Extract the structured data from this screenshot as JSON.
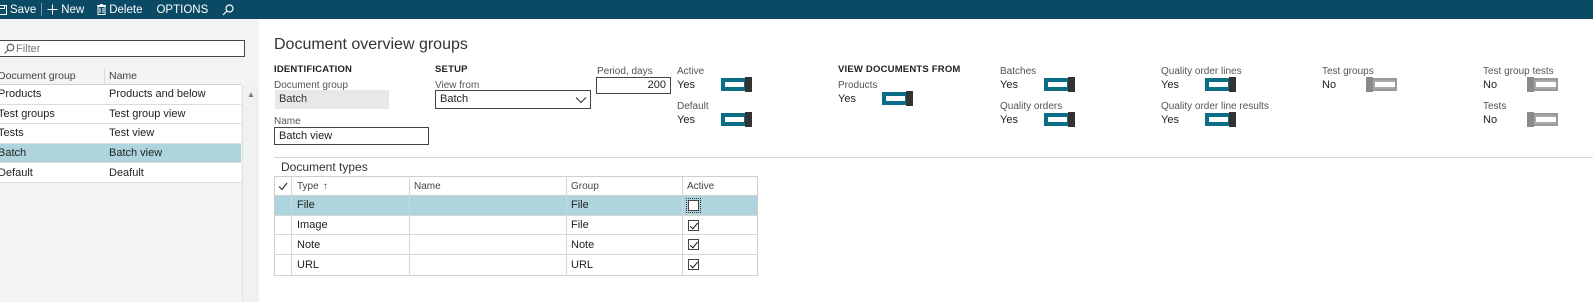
{
  "toolbar": {
    "save": "Save",
    "new": "New",
    "delete": "Delete",
    "options": "OPTIONS"
  },
  "left": {
    "filter_placeholder": "Filter",
    "col_group": "Document group",
    "col_name": "Name",
    "rows": [
      {
        "group": "Products",
        "name": "Products and below",
        "selected": false
      },
      {
        "group": "Test groups",
        "name": "Test group view",
        "selected": false
      },
      {
        "group": "Tests",
        "name": "Test view",
        "selected": false
      },
      {
        "group": "Batch",
        "name": "Batch view",
        "selected": true
      },
      {
        "group": "Default",
        "name": "Deafult",
        "selected": false
      }
    ]
  },
  "main": {
    "title": "Document overview groups",
    "identification": {
      "header": "IDENTIFICATION",
      "doc_group_label": "Document group",
      "doc_group_value": "Batch",
      "name_label": "Name",
      "name_value": "Batch view"
    },
    "setup": {
      "header": "SETUP",
      "view_from_label": "View from",
      "view_from_value": "Batch",
      "period_label": "Period, days",
      "period_value": "200",
      "active_label": "Active",
      "active_value": "Yes",
      "default_label": "Default",
      "default_value": "Yes"
    },
    "view_docs": {
      "header": "VIEW DOCUMENTS FROM",
      "products_label": "Products",
      "products_value": "Yes",
      "batches_label": "Batches",
      "batches_value": "Yes",
      "quality_orders_label": "Quality orders",
      "quality_orders_value": "Yes",
      "qo_lines_label": "Quality order lines",
      "qo_lines_value": "Yes",
      "qo_line_results_label": "Quality order line results",
      "qo_line_results_value": "Yes",
      "test_groups_label": "Test groups",
      "test_groups_value": "No",
      "test_group_tests_label": "Test group tests",
      "test_group_tests_value": "No",
      "tests_label": "Tests",
      "tests_value": "No"
    },
    "doc_types": {
      "title": "Document types",
      "col_type": "Type",
      "sort_indicator": "↑",
      "col_name": "Name",
      "col_group": "Group",
      "col_active": "Active",
      "rows": [
        {
          "type": "File",
          "name": "",
          "group": "File",
          "active": false,
          "selected": true
        },
        {
          "type": "Image",
          "name": "",
          "group": "File",
          "active": true,
          "selected": false
        },
        {
          "type": "Note",
          "name": "",
          "group": "Note",
          "active": true,
          "selected": false
        },
        {
          "type": "URL",
          "name": "",
          "group": "URL",
          "active": true,
          "selected": false
        }
      ]
    }
  },
  "colors": {
    "toolbar_bg": "#0b4a64",
    "toggle_on": "#0a6f86",
    "selection": "#aed5dd"
  }
}
